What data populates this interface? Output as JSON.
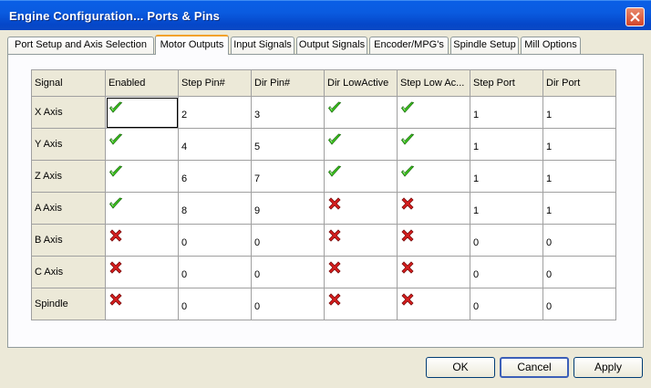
{
  "window": {
    "title": "Engine Configuration... Ports & Pins"
  },
  "tabs": [
    {
      "label": "Port Setup and Axis Selection",
      "active": false
    },
    {
      "label": "Motor Outputs",
      "active": true
    },
    {
      "label": "Input Signals",
      "active": false
    },
    {
      "label": "Output Signals",
      "active": false
    },
    {
      "label": "Encoder/MPG's",
      "active": false
    },
    {
      "label": "Spindle Setup",
      "active": false
    },
    {
      "label": "Mill Options",
      "active": false
    }
  ],
  "grid": {
    "columns": [
      "Signal",
      "Enabled",
      "Step Pin#",
      "Dir Pin#",
      "Dir LowActive",
      "Step Low Ac...",
      "Step Port",
      "Dir Port"
    ],
    "rows": [
      {
        "signal": "X Axis",
        "enabled": true,
        "step_pin": "2",
        "dir_pin": "3",
        "dir_low_active": true,
        "step_low_active": true,
        "step_port": "1",
        "dir_port": "1"
      },
      {
        "signal": "Y Axis",
        "enabled": true,
        "step_pin": "4",
        "dir_pin": "5",
        "dir_low_active": true,
        "step_low_active": true,
        "step_port": "1",
        "dir_port": "1"
      },
      {
        "signal": "Z Axis",
        "enabled": true,
        "step_pin": "6",
        "dir_pin": "7",
        "dir_low_active": true,
        "step_low_active": true,
        "step_port": "1",
        "dir_port": "1"
      },
      {
        "signal": "A Axis",
        "enabled": true,
        "step_pin": "8",
        "dir_pin": "9",
        "dir_low_active": false,
        "step_low_active": false,
        "step_port": "1",
        "dir_port": "1"
      },
      {
        "signal": "B Axis",
        "enabled": false,
        "step_pin": "0",
        "dir_pin": "0",
        "dir_low_active": false,
        "step_low_active": false,
        "step_port": "0",
        "dir_port": "0"
      },
      {
        "signal": "C Axis",
        "enabled": false,
        "step_pin": "0",
        "dir_pin": "0",
        "dir_low_active": false,
        "step_low_active": false,
        "step_port": "0",
        "dir_port": "0"
      },
      {
        "signal": "Spindle",
        "enabled": false,
        "step_pin": "0",
        "dir_pin": "0",
        "dir_low_active": false,
        "step_low_active": false,
        "step_port": "0",
        "dir_port": "0"
      }
    ],
    "selected": {
      "row": 0,
      "col": "enabled"
    }
  },
  "buttons": {
    "ok": "OK",
    "cancel": "Cancel",
    "apply": "Apply"
  },
  "icons": {
    "true": "green-check-icon",
    "false": "red-x-icon"
  },
  "colors": {
    "check": "#3ccc1c",
    "cross": "#d81e1e",
    "titlebar": "#0a5be0",
    "face": "#ece9d8"
  }
}
